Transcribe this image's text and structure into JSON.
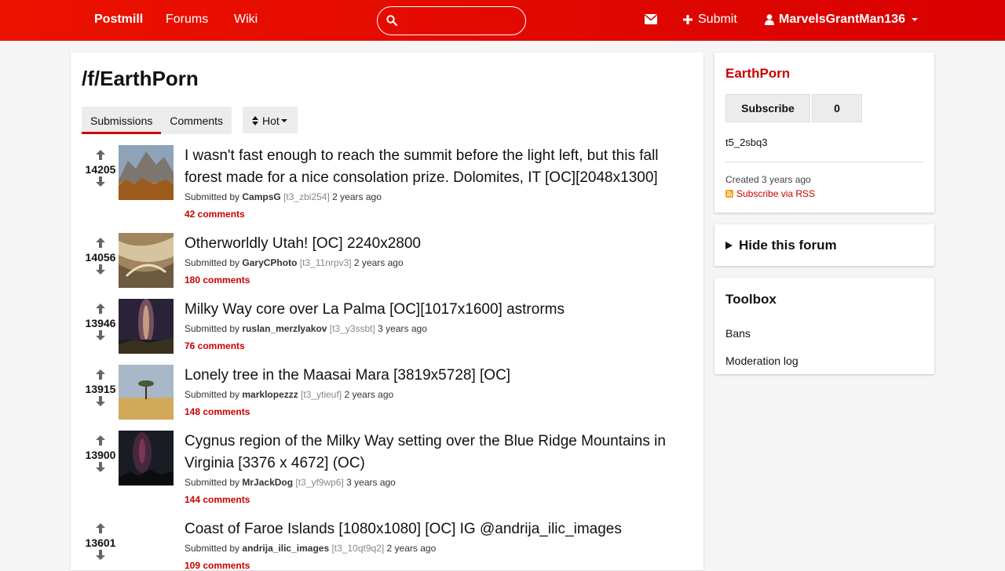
{
  "navbar": {
    "brand": "Postmill",
    "links": [
      "Forums",
      "Wiki"
    ],
    "search": {
      "placeholder": "",
      "value": ""
    },
    "submit_label": "Submit",
    "username": "MarvelsGrantMan136"
  },
  "forum": {
    "title": "/f/EarthPorn",
    "tabs": [
      "Submissions",
      "Comments"
    ],
    "active_tab": "Submissions",
    "sort": "Hot"
  },
  "posts": [
    {
      "score": "14205",
      "title": "I wasn't fast enough to reach the summit before the light left, but this fall forest made for a nice consolation prize. Dolomites, IT [OC][2048x1300]",
      "submitted_by": "Submitted by",
      "author": "CampsG",
      "id": "[t3_zbi254]",
      "age": "2 years ago",
      "comments": "42 comments"
    },
    {
      "score": "14056",
      "title": "Otherworldly Utah! [OC] 2240x2800",
      "submitted_by": "Submitted by",
      "author": "GaryCPhoto",
      "id": "[t3_11nrpv3]",
      "age": "2 years ago",
      "comments": "180 comments"
    },
    {
      "score": "13946",
      "title": "Milky Way core over La Palma [OC][1017x1600] astrorms",
      "submitted_by": "Submitted by",
      "author": "ruslan_merzlyakov",
      "id": "[t3_y3ssbt]",
      "age": "3 years ago",
      "comments": "76 comments"
    },
    {
      "score": "13915",
      "title": "Lonely tree in the Maasai Mara [3819x5728] [OC]",
      "submitted_by": "Submitted by",
      "author": "marklopezzz",
      "id": "[t3_ytieuf]",
      "age": "2 years ago",
      "comments": "148 comments"
    },
    {
      "score": "13900",
      "title": "Cygnus region of the Milky Way setting over the Blue Ridge Mountains in Virginia [3376 x 4672] (OC)",
      "submitted_by": "Submitted by",
      "author": "MrJackDog",
      "id": "[t3_yf9wp6]",
      "age": "3 years ago",
      "comments": "144 comments"
    },
    {
      "score": "13601",
      "title": "Coast of Faroe Islands [1080x1080] [OC] IG @andrija_ilic_images",
      "submitted_by": "Submitted by",
      "author": "andrija_ilic_images",
      "id": "[t3_10qt9q2]",
      "age": "2 years ago",
      "comments": "109 comments"
    }
  ],
  "sidebar": {
    "forum_name": "EarthPorn",
    "subscribe_label": "Subscribe",
    "subscriber_count": "0",
    "forum_id": "t5_2sbq3",
    "created": "Created 3 years ago",
    "rss_label": "Subscribe via RSS",
    "hide_label": "Hide this forum",
    "toolbox_title": "Toolbox",
    "toolbox_links": [
      "Bans",
      "Moderation log"
    ]
  },
  "colors": {
    "accent": "#d80000",
    "link": "#c80000"
  }
}
